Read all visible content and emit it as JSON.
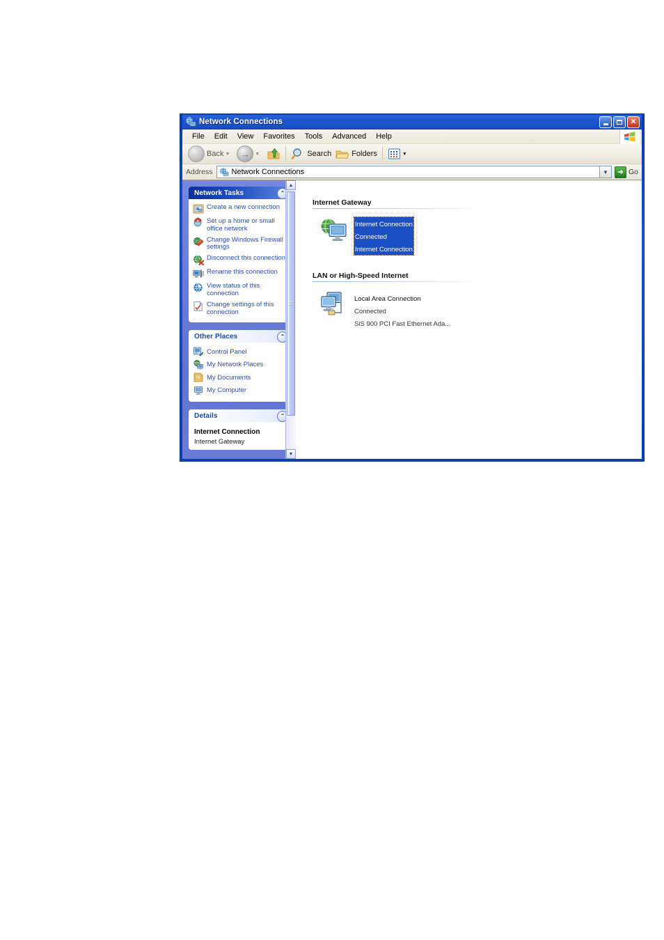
{
  "window": {
    "title": "Network Connections",
    "titlebar_icon": "network-connections-icon",
    "buttons": {
      "minimize": "Minimize",
      "maximize": "Maximize",
      "close": "Close"
    }
  },
  "menubar": {
    "items": [
      {
        "label": "File"
      },
      {
        "label": "Edit"
      },
      {
        "label": "View"
      },
      {
        "label": "Favorites"
      },
      {
        "label": "Tools"
      },
      {
        "label": "Advanced"
      },
      {
        "label": "Help"
      }
    ],
    "logo": "windows-flag-logo"
  },
  "toolbar": {
    "back_label": "Back",
    "forward_label": "",
    "up_label": "",
    "search_label": "Search",
    "folders_label": "Folders",
    "views_label": ""
  },
  "addressbar": {
    "label": "Address",
    "value": "Network Connections",
    "icon": "network-globe-icon",
    "go_label": "Go"
  },
  "sidebar": {
    "network_tasks": {
      "title": "Network Tasks",
      "items": [
        {
          "label": "Create a new connection",
          "icon": "new-connection-icon"
        },
        {
          "label": "Set up a home or small office network",
          "icon": "home-network-icon"
        },
        {
          "label": "Change Windows Firewall settings",
          "icon": "firewall-icon"
        },
        {
          "label": "Disconnect this connection",
          "icon": "disconnect-icon"
        },
        {
          "label": "Rename this connection",
          "icon": "rename-icon"
        },
        {
          "label": "View status of this connection",
          "icon": "status-icon"
        },
        {
          "label": "Change settings of this connection",
          "icon": "settings-icon"
        }
      ]
    },
    "other_places": {
      "title": "Other Places",
      "items": [
        {
          "label": "Control Panel",
          "icon": "control-panel-icon"
        },
        {
          "label": "My Network Places",
          "icon": "network-places-icon"
        },
        {
          "label": "My Documents",
          "icon": "documents-icon"
        },
        {
          "label": "My Computer",
          "icon": "computer-icon"
        }
      ]
    },
    "details": {
      "title": "Details",
      "name": "Internet Connection",
      "type": "Internet Gateway"
    }
  },
  "content": {
    "groups": [
      {
        "heading": "Internet Gateway",
        "items": [
          {
            "name": "Internet Connection",
            "status": "Connected",
            "device": "Internet Connection",
            "selected": true,
            "icon": "internet-gateway-icon"
          }
        ]
      },
      {
        "heading": "LAN or High-Speed Internet",
        "items": [
          {
            "name": "Local Area Connection",
            "status": "Connected",
            "device": "SiS 900 PCI Fast Ethernet Ada...",
            "selected": false,
            "icon": "lan-connection-icon"
          }
        ]
      }
    ]
  },
  "colors": {
    "titlebar_blue": "#1b55d1",
    "selection_blue": "#1b4fc6",
    "sidepanel_blue": "#6c80d8",
    "link_blue": "#2a4fa8",
    "client_beige": "#ece9d8"
  }
}
